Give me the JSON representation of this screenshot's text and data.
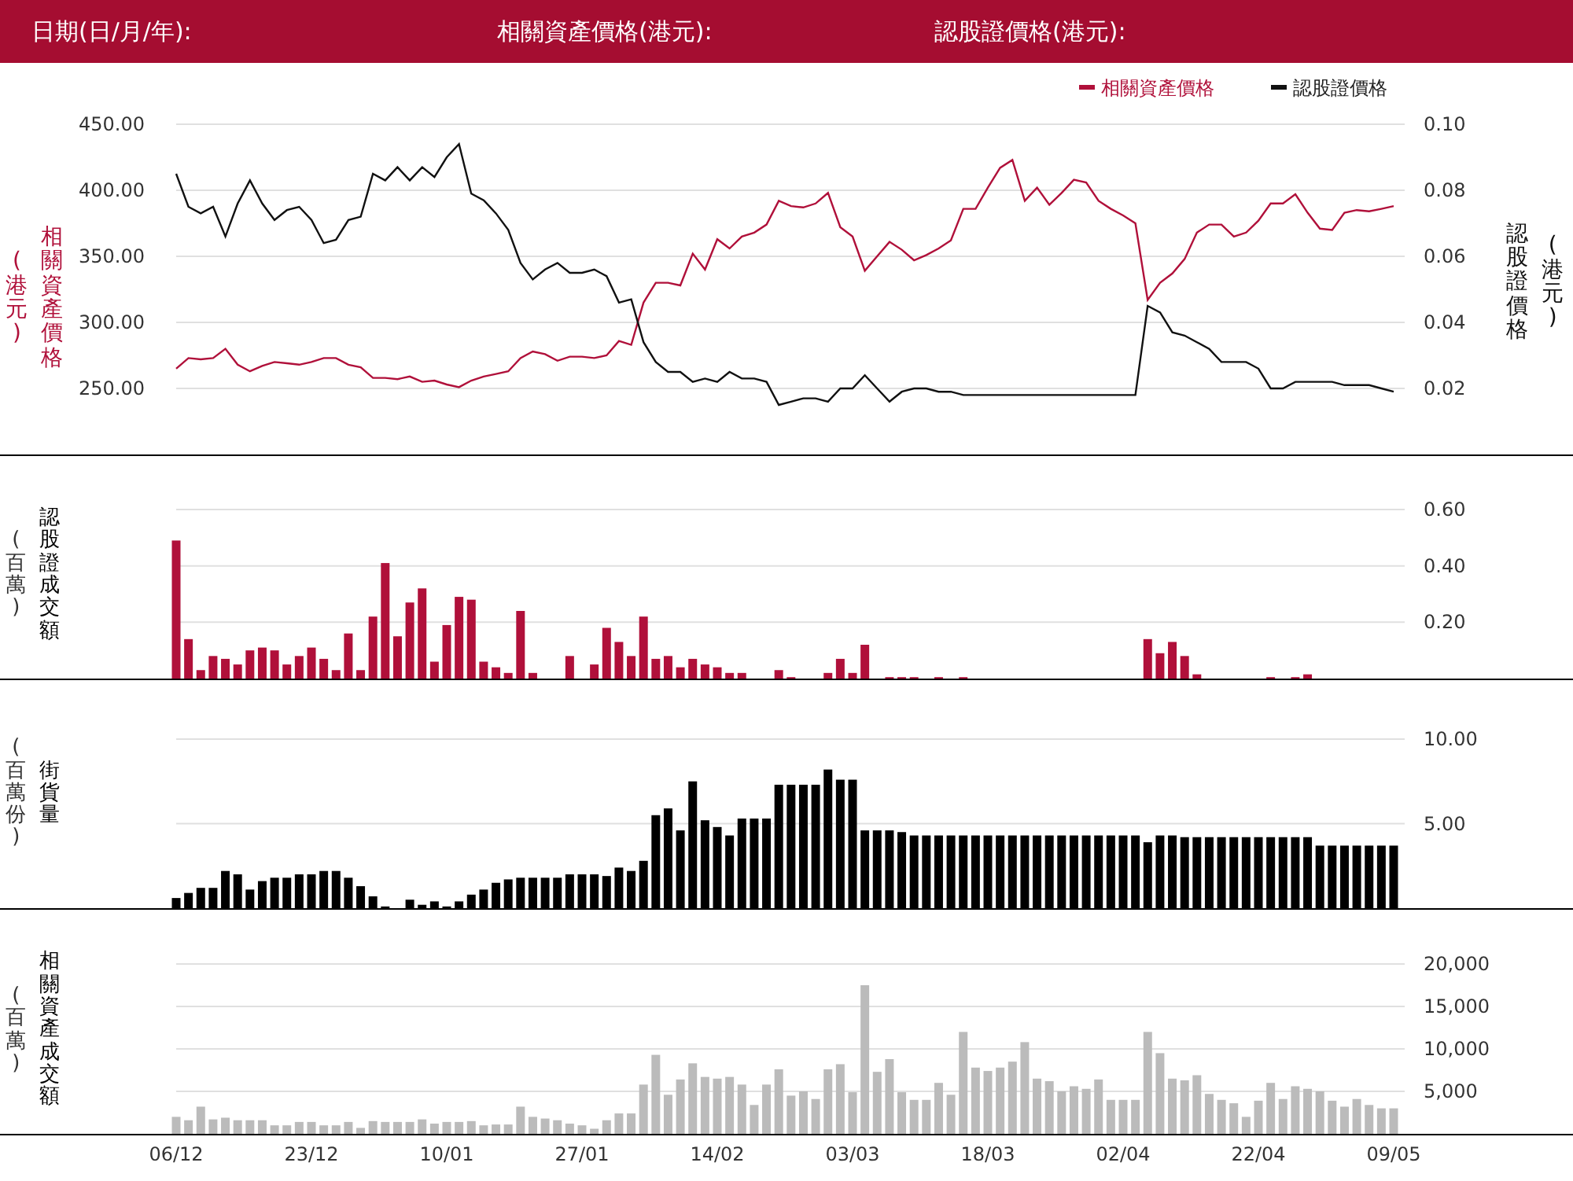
{
  "header": [
    {
      "label": "日期(日/月/年):"
    },
    {
      "label": "相關資產價格(港元):"
    },
    {
      "label": "認股證價格(港元):"
    }
  ],
  "panels": [
    {
      "left_titles": [
        "(港元)",
        "相關資產價格"
      ],
      "right_titles": [
        "認股證價格",
        "(港元)"
      ],
      "chart_data": {
        "type": "line",
        "grid": true,
        "legend": true,
        "ylim": [
          200,
          450
        ],
        "yticks": [
          {
            "value": 250,
            "label": "250.00"
          },
          {
            "value": 300,
            "label": "300.00"
          },
          {
            "value": 350,
            "label": "350.00"
          },
          {
            "value": 400,
            "label": "400.00"
          },
          {
            "value": 450,
            "label": "450.00"
          }
        ],
        "y2lim": [
          0,
          0.1
        ],
        "y2ticks": [
          {
            "value": 0.02,
            "label": "0.02"
          },
          {
            "value": 0.04,
            "label": "0.04"
          },
          {
            "value": 0.06,
            "label": "0.06"
          },
          {
            "value": 0.08,
            "label": "0.08"
          },
          {
            "value": 0.1,
            "label": "0.10"
          }
        ],
        "series": [
          {
            "name": "相關資產價格",
            "color": "#b0103a",
            "values": [
              265,
              273,
              272,
              273,
              280,
              268,
              263,
              267,
              270,
              269,
              268,
              270,
              273,
              273,
              268,
              266,
              258,
              258,
              257,
              259,
              255,
              256,
              253,
              251,
              256,
              259,
              261,
              263,
              273,
              278,
              276,
              271,
              274,
              274,
              273,
              275,
              286,
              283,
              315,
              330,
              330,
              328,
              352,
              340,
              363,
              356,
              365,
              368,
              374,
              392,
              388,
              387,
              390,
              398,
              372,
              365,
              339,
              350,
              361,
              355,
              347,
              351,
              356,
              362,
              386,
              386,
              402,
              417,
              423,
              392,
              402,
              389,
              398,
              408,
              406,
              392,
              386,
              381,
              375,
              317,
              330,
              337,
              348,
              368,
              374,
              374,
              365,
              368,
              377,
              390,
              390,
              397,
              383,
              371,
              370,
              383,
              385,
              384,
              386,
              388
            ]
          },
          {
            "name": "認股證價格",
            "color": "#111111",
            "axis": "y2",
            "values": [
              0.085,
              0.075,
              0.073,
              0.075,
              0.066,
              0.076,
              0.083,
              0.076,
              0.071,
              0.074,
              0.075,
              0.071,
              0.064,
              0.065,
              0.071,
              0.072,
              0.085,
              0.083,
              0.087,
              0.083,
              0.087,
              0.084,
              0.09,
              0.094,
              0.079,
              0.077,
              0.073,
              0.068,
              0.058,
              0.053,
              0.056,
              0.058,
              0.055,
              0.055,
              0.056,
              0.054,
              0.046,
              0.047,
              0.034,
              0.028,
              0.025,
              0.025,
              0.022,
              0.023,
              0.022,
              0.025,
              0.023,
              0.023,
              0.022,
              0.015,
              0.016,
              0.017,
              0.017,
              0.016,
              0.02,
              0.02,
              0.024,
              0.02,
              0.016,
              0.019,
              0.02,
              0.02,
              0.019,
              0.019,
              0.018,
              0.018,
              0.018,
              0.018,
              0.018,
              0.018,
              0.018,
              0.018,
              0.018,
              0.018,
              0.018,
              0.018,
              0.018,
              0.018,
              0.018,
              0.045,
              0.043,
              0.037,
              0.036,
              0.034,
              0.032,
              0.028,
              0.028,
              0.028,
              0.026,
              0.02,
              0.02,
              0.022,
              0.022,
              0.022,
              0.022,
              0.021,
              0.021,
              0.021,
              0.02,
              0.019
            ]
          }
        ]
      }
    },
    {
      "left_titles": [
        "(百萬)"
      ],
      "chart_data": {
        "type": "bar",
        "grid": true,
        "ylim": [
          0,
          0.6
        ],
        "yticks": [
          {
            "value": 0.2,
            "label": "0.20"
          },
          {
            "value": 0.4,
            "label": "0.40"
          },
          {
            "value": 0.6,
            "label": "0.60"
          }
        ],
        "series": [
          {
            "name": "認股證成交額",
            "color": "#b0103a",
            "values": [
              0.49,
              0.14,
              0.03,
              0.08,
              0.07,
              0.05,
              0.1,
              0.11,
              0.1,
              0.05,
              0.08,
              0.11,
              0.07,
              0.03,
              0.16,
              0.03,
              0.22,
              0.41,
              0.15,
              0.27,
              0.32,
              0.06,
              0.19,
              0.29,
              0.28,
              0.06,
              0.04,
              0.02,
              0.24,
              0.02,
              0,
              0,
              0.08,
              0,
              0.05,
              0.18,
              0.13,
              0.08,
              0.22,
              0.07,
              0.08,
              0.04,
              0.07,
              0.05,
              0.04,
              0.02,
              0.02,
              0,
              0,
              0.03,
              0.005,
              0,
              0,
              0.02,
              0.07,
              0.02,
              0.12,
              0,
              0.005,
              0.005,
              0.005,
              0,
              0.005,
              0,
              0.005,
              0,
              0,
              0,
              0,
              0,
              0,
              0,
              0,
              0,
              0,
              0,
              0,
              0,
              0,
              0.14,
              0.09,
              0.13,
              0.08,
              0.015,
              0,
              0,
              0,
              0,
              0,
              0.005,
              0,
              0.005,
              0.015,
              0,
              0,
              0,
              0,
              0,
              0,
              0
            ]
          }
        ]
      }
    },
    {
      "left_titles": [
        "(百萬份)"
      ],
      "chart_data": {
        "type": "bar",
        "grid": true,
        "ylim": [
          0,
          10
        ],
        "yticks": [
          {
            "value": 5,
            "label": "5.00"
          },
          {
            "value": 10,
            "label": "10.00"
          }
        ],
        "series": [
          {
            "name": "街貨量",
            "color": "#000000",
            "values": [
              0.6,
              0.9,
              1.2,
              1.2,
              2.2,
              2.0,
              1.1,
              1.6,
              1.8,
              1.8,
              2.0,
              2.0,
              2.2,
              2.2,
              1.8,
              1.3,
              0.7,
              0.1,
              0,
              0.5,
              0.2,
              0.4,
              0.1,
              0.4,
              0.8,
              1.1,
              1.5,
              1.7,
              1.8,
              1.8,
              1.8,
              1.8,
              2.0,
              2.0,
              2.0,
              1.9,
              2.4,
              2.2,
              2.8,
              5.5,
              5.9,
              4.6,
              7.5,
              5.2,
              4.8,
              4.3,
              5.3,
              5.3,
              5.3,
              7.3,
              7.3,
              7.3,
              7.3,
              8.2,
              7.6,
              7.6,
              4.6,
              4.6,
              4.6,
              4.5,
              4.3,
              4.3,
              4.3,
              4.3,
              4.3,
              4.3,
              4.3,
              4.3,
              4.3,
              4.3,
              4.3,
              4.3,
              4.3,
              4.3,
              4.3,
              4.3,
              4.3,
              4.3,
              4.3,
              3.9,
              4.3,
              4.3,
              4.2,
              4.2,
              4.2,
              4.2,
              4.2,
              4.2,
              4.2,
              4.2,
              4.2,
              4.2,
              4.2,
              3.7,
              3.7,
              3.7,
              3.7,
              3.7,
              3.7,
              3.7
            ]
          }
        ]
      }
    },
    {
      "left_titles": [
        "(百萬)"
      ],
      "x_labels": [
        "06/12",
        "23/12",
        "10/01",
        "27/01",
        "14/02",
        "03/03",
        "18/03",
        "02/04",
        "22/04",
        "09/05"
      ],
      "chart_data": {
        "type": "bar",
        "grid": true,
        "ylim": [
          0,
          20000
        ],
        "yticks": [
          {
            "value": 5000,
            "label": "5,000"
          },
          {
            "value": 10000,
            "label": "10,000"
          },
          {
            "value": 15000,
            "label": "15,000"
          },
          {
            "value": 20000,
            "label": "20,000"
          }
        ],
        "series": [
          {
            "name": "相關資產成交額",
            "color": "#bbbbbb",
            "values": [
              2000,
              1600,
              3200,
              1700,
              1900,
              1600,
              1600,
              1600,
              1000,
              1000,
              1400,
              1400,
              1000,
              1000,
              1400,
              700,
              1500,
              1400,
              1400,
              1400,
              1700,
              1200,
              1400,
              1400,
              1500,
              1000,
              1100,
              1100,
              3200,
              2000,
              1800,
              1600,
              1200,
              1000,
              600,
              1600,
              2400,
              2400,
              5800,
              9300,
              4600,
              6400,
              8300,
              6700,
              6500,
              6700,
              5800,
              3400,
              5800,
              7600,
              4500,
              5000,
              4100,
              7600,
              8200,
              4900,
              17500,
              7300,
              8800,
              4900,
              4000,
              4000,
              6000,
              4600,
              12000,
              7800,
              7400,
              7800,
              8500,
              10800,
              6500,
              6200,
              5000,
              5600,
              5300,
              6400,
              4000,
              4000,
              4000,
              12000,
              9500,
              6500,
              6300,
              6900,
              4700,
              4000,
              3600,
              2000,
              3900,
              6000,
              4100,
              5600,
              5300,
              5000,
              3900,
              3200,
              4100,
              3400,
              3000,
              3000
            ]
          }
        ]
      }
    }
  ]
}
